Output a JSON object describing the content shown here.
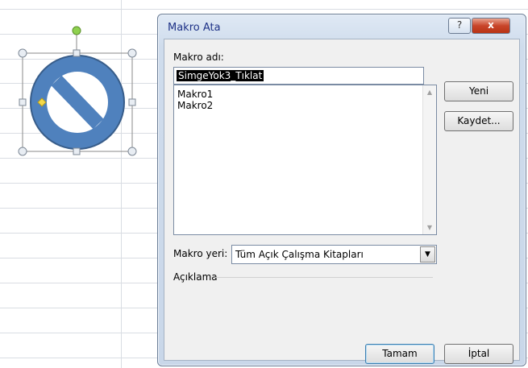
{
  "dialog": {
    "title": "Makro Ata",
    "help_label": "?",
    "close_label": "x",
    "macro_name_label": "Makro adı:",
    "macro_name_value": "SimgeYok3_Tıklat",
    "macros": [
      "Makro1",
      "Makro2"
    ],
    "macro_location_label": "Makro yeri:",
    "macro_location_value": "Tüm Açık Çalışma Kitapları",
    "description_label": "Açıklama",
    "buttons": {
      "new": "Yeni",
      "record": "Kaydet...",
      "ok": "Tamam",
      "cancel": "İptal"
    }
  },
  "shape": {
    "icon": "no-symbol-icon",
    "fill": "#4f81bd",
    "stroke": "#385d8a"
  }
}
